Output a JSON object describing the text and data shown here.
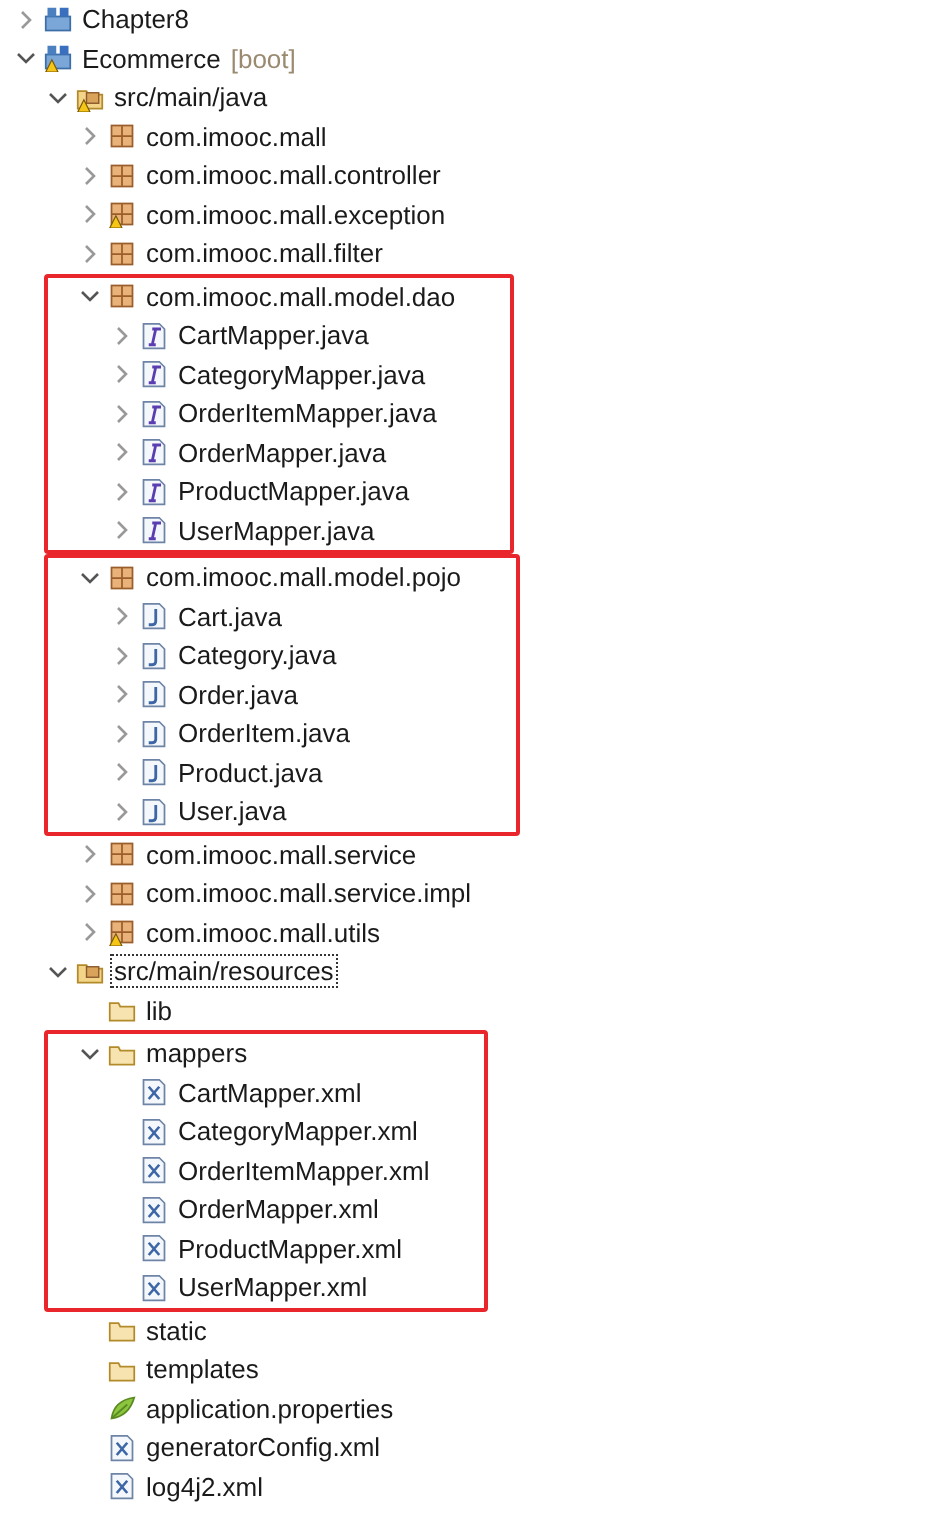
{
  "tree": [
    {
      "label": "Chapter8",
      "kind": "project",
      "expanded": false,
      "warning": false
    },
    {
      "label": "Ecommerce",
      "decoration": "[boot]",
      "kind": "project",
      "expanded": true,
      "warning": true,
      "children": [
        {
          "label": "src/main/java",
          "kind": "source-folder",
          "expanded": true,
          "warning": true,
          "children": [
            {
              "label": "com.imooc.mall",
              "kind": "package",
              "expanded": false,
              "warning": false
            },
            {
              "label": "com.imooc.mall.controller",
              "kind": "package",
              "expanded": false,
              "warning": false
            },
            {
              "label": "com.imooc.mall.exception",
              "kind": "package",
              "expanded": false,
              "warning": true
            },
            {
              "label": "com.imooc.mall.filter",
              "kind": "package",
              "expanded": false,
              "warning": false
            },
            {
              "label": "com.imooc.mall.model.dao",
              "kind": "package",
              "expanded": true,
              "warning": false,
              "highlighted": true,
              "children": [
                {
                  "label": "CartMapper.java",
                  "kind": "interface",
                  "expanded": false,
                  "warning": false
                },
                {
                  "label": "CategoryMapper.java",
                  "kind": "interface",
                  "expanded": false,
                  "warning": false
                },
                {
                  "label": "OrderItemMapper.java",
                  "kind": "interface",
                  "expanded": false,
                  "warning": false
                },
                {
                  "label": "OrderMapper.java",
                  "kind": "interface",
                  "expanded": false,
                  "warning": false
                },
                {
                  "label": "ProductMapper.java",
                  "kind": "interface",
                  "expanded": false,
                  "warning": false
                },
                {
                  "label": "UserMapper.java",
                  "kind": "interface",
                  "expanded": false,
                  "warning": false
                }
              ]
            },
            {
              "label": "com.imooc.mall.model.pojo",
              "kind": "package",
              "expanded": true,
              "warning": false,
              "highlighted": true,
              "children": [
                {
                  "label": "Cart.java",
                  "kind": "class",
                  "expanded": false,
                  "warning": false
                },
                {
                  "label": "Category.java",
                  "kind": "class",
                  "expanded": false,
                  "warning": false
                },
                {
                  "label": "Order.java",
                  "kind": "class",
                  "expanded": false,
                  "warning": false
                },
                {
                  "label": "OrderItem.java",
                  "kind": "class",
                  "expanded": false,
                  "warning": false
                },
                {
                  "label": "Product.java",
                  "kind": "class",
                  "expanded": false,
                  "warning": false
                },
                {
                  "label": "User.java",
                  "kind": "class",
                  "expanded": false,
                  "warning": false
                }
              ]
            },
            {
              "label": "com.imooc.mall.service",
              "kind": "package",
              "expanded": false,
              "warning": false
            },
            {
              "label": "com.imooc.mall.service.impl",
              "kind": "package",
              "expanded": false,
              "warning": false
            },
            {
              "label": "com.imooc.mall.utils",
              "kind": "package",
              "expanded": false,
              "warning": true
            }
          ]
        },
        {
          "label": "src/main/resources",
          "kind": "source-folder",
          "expanded": true,
          "warning": false,
          "focused": true,
          "children": [
            {
              "label": "lib",
              "kind": "folder",
              "warning": false
            },
            {
              "label": "mappers",
              "kind": "folder",
              "expanded": true,
              "warning": false,
              "highlighted": true,
              "children": [
                {
                  "label": "CartMapper.xml",
                  "kind": "xml",
                  "warning": false
                },
                {
                  "label": "CategoryMapper.xml",
                  "kind": "xml",
                  "warning": false
                },
                {
                  "label": "OrderItemMapper.xml",
                  "kind": "xml",
                  "warning": false
                },
                {
                  "label": "OrderMapper.xml",
                  "kind": "xml",
                  "warning": false
                },
                {
                  "label": "ProductMapper.xml",
                  "kind": "xml",
                  "warning": false
                },
                {
                  "label": "UserMapper.xml",
                  "kind": "xml",
                  "warning": false
                }
              ]
            },
            {
              "label": "static",
              "kind": "folder",
              "warning": false
            },
            {
              "label": "templates",
              "kind": "folder",
              "warning": false
            },
            {
              "label": "application.properties",
              "kind": "properties",
              "warning": false
            },
            {
              "label": "generatorConfig.xml",
              "kind": "xml",
              "warning": false
            },
            {
              "label": "log4j2.xml",
              "kind": "xml",
              "warning": false
            }
          ]
        }
      ]
    }
  ]
}
